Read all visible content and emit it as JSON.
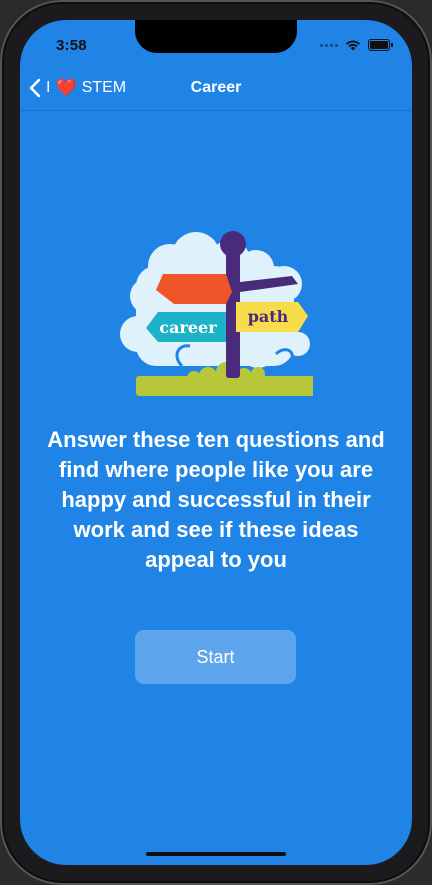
{
  "status_bar": {
    "time": "3:58"
  },
  "navbar": {
    "back_prefix": "I",
    "back_heart": "❤️",
    "back_label": "STEM",
    "title": "Career"
  },
  "illustration": {
    "sign_left": "career",
    "sign_right": "path"
  },
  "main": {
    "message": "Answer these ten questions and find where people like you are happy and successful in their work and see if these ideas appeal to you",
    "start_label": "Start"
  },
  "colors": {
    "background": "#1f84e6",
    "button": "#5da6ef",
    "text": "#ffffff"
  }
}
